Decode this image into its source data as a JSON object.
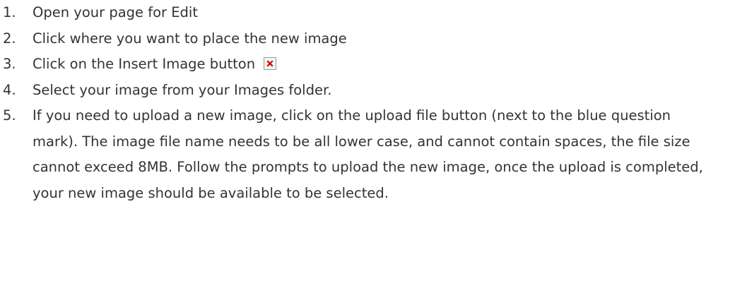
{
  "steps": [
    {
      "number": "1.",
      "text": "Open your page for Edit"
    },
    {
      "number": "2.",
      "text": "Click where you want to place the new image"
    },
    {
      "number": "3.",
      "text": "Click on the Insert Image button",
      "icon": "broken-image-icon"
    },
    {
      "number": "4.",
      "text": "Select your image from your Images folder."
    },
    {
      "number": "5.",
      "text": "If you need to upload a new image, click on the upload file button (next to the blue question mark). The image file name needs to be all lower case, and cannot contain spaces, the  file size cannot exceed 8MB. Follow the prompts to upload the new image, once the upload is completed, your new image should be available to be selected."
    }
  ],
  "colors": {
    "text": "#333333",
    "icon_x": "#cc0000"
  }
}
